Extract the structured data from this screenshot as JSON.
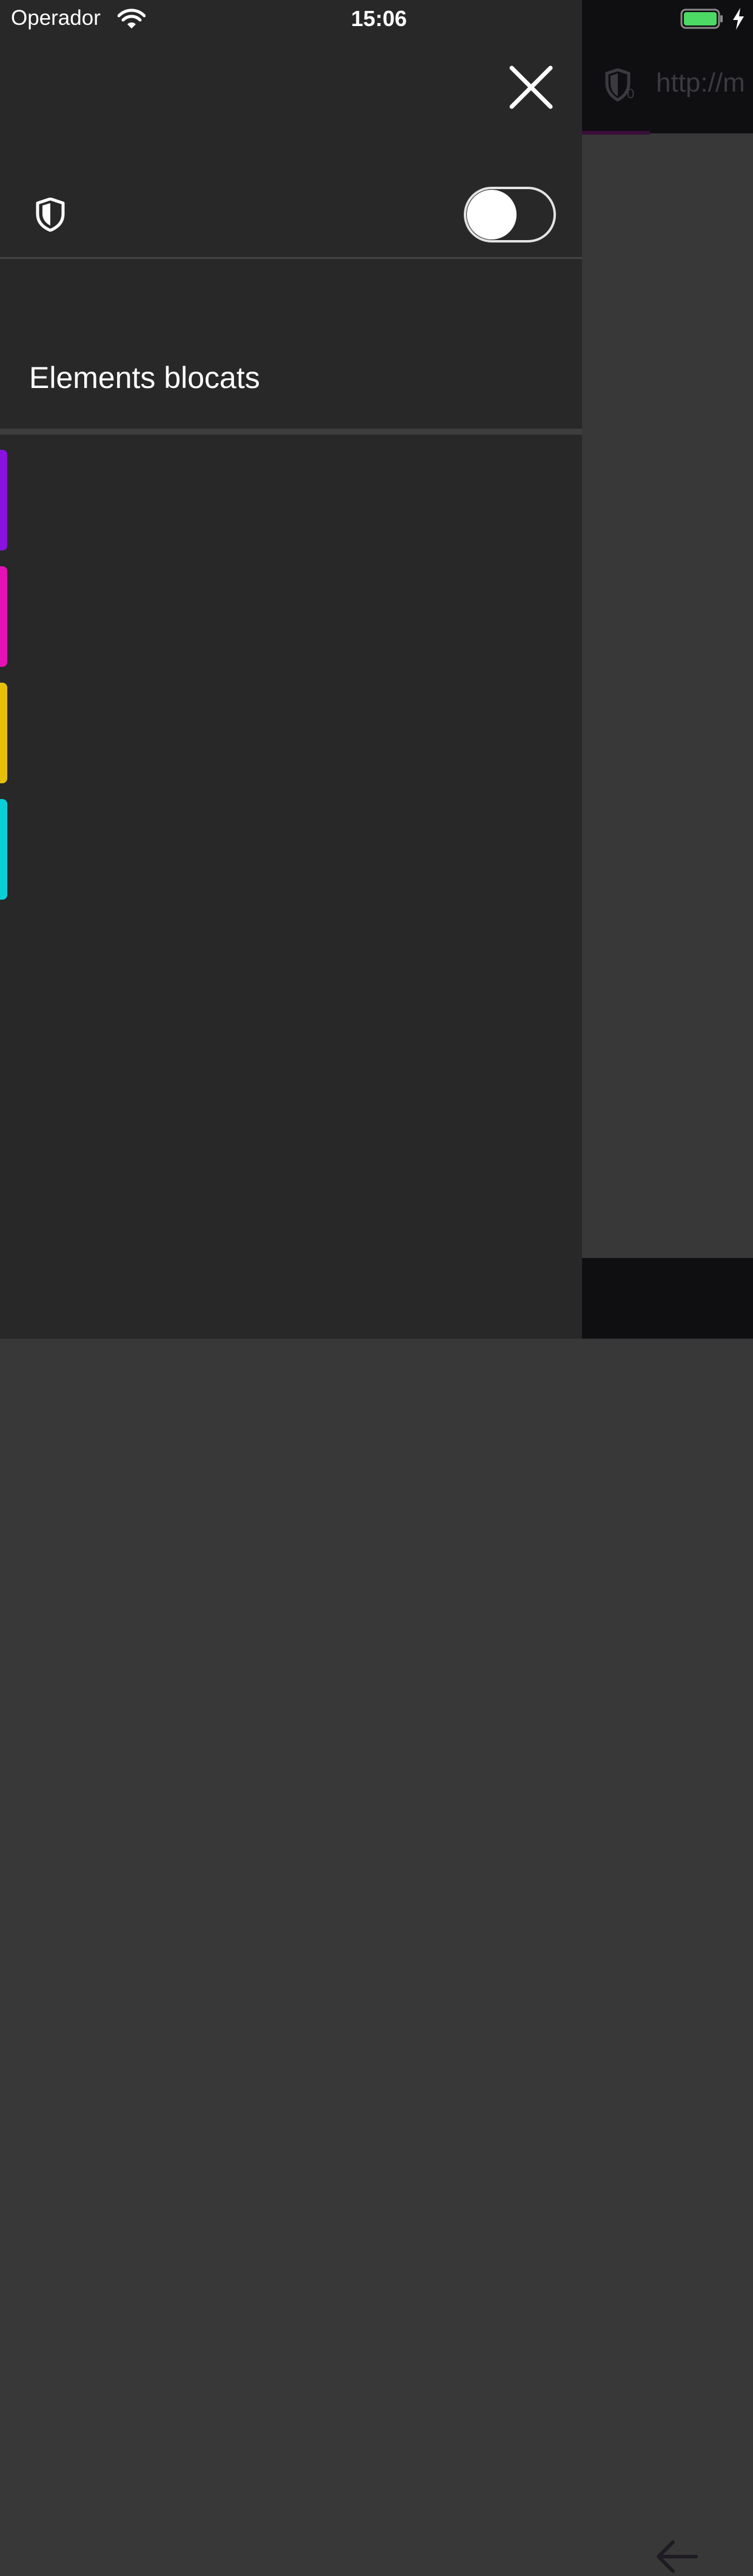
{
  "status_bar": {
    "carrier": "Operador",
    "time": "15:06",
    "battery_color": "#4cd964"
  },
  "background_browser": {
    "url_text": "http://m",
    "shield_badge": "0",
    "progress_color": "#3b0d3a"
  },
  "panel": {
    "close_icon": "close-icon",
    "shield_icon": "shield-icon",
    "toggle_enabled": false,
    "section_title": "Elements blocats",
    "tracker_categories": [
      {
        "color": "#8a12e0"
      },
      {
        "color": "#e412b4"
      },
      {
        "color": "#e5bf0a"
      },
      {
        "color": "#0acfd7"
      }
    ]
  }
}
